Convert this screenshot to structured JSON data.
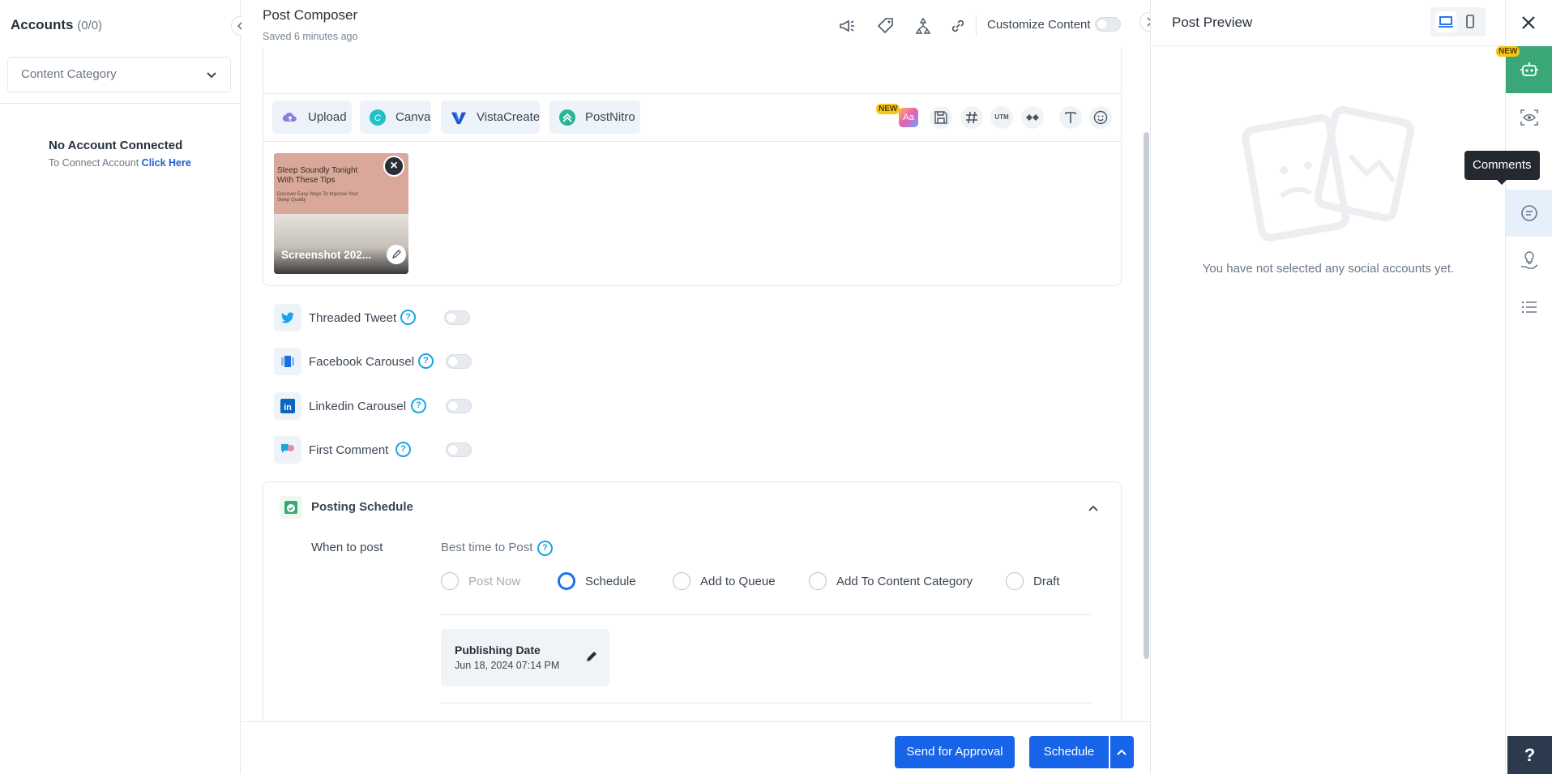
{
  "left_panel": {
    "title": "Accounts",
    "count": "(0/0)",
    "category_placeholder": "Content Category",
    "no_account": "No Account Connected",
    "connect_text": "To Connect Account",
    "connect_link": "Click Here"
  },
  "composer": {
    "title": "Post Composer",
    "saved": "Saved 6 minutes ago",
    "customize_label": "Customize Content",
    "header_icons": [
      "megaphone-icon",
      "tag-icon",
      "hierarchy-icon",
      "link-icon"
    ],
    "media_buttons": [
      {
        "label": "Upload",
        "icon": "cloud-upload-icon"
      },
      {
        "label": "Canva",
        "icon": "canva-icon"
      },
      {
        "label": "VistaCreate",
        "icon": "vistacreate-icon"
      },
      {
        "label": "PostNitro",
        "icon": "postnitro-icon"
      }
    ],
    "toolbar_new_badge": "NEW",
    "toolbar_ai_label": "Aa",
    "utm_label": "UTM",
    "thumbnail": {
      "headline": "Sleep Soundly Tonight With These Tips",
      "subline": "Discover Easy Ways To Improve Your Sleep Quality",
      "name": "Screenshot 202..."
    },
    "options": [
      {
        "label": "Threaded Tweet",
        "icon": "twitter-icon"
      },
      {
        "label": "Facebook Carousel",
        "icon": "carousel-icon"
      },
      {
        "label": "Linkedin Carousel",
        "icon": "linkedin-icon"
      },
      {
        "label": "First Comment",
        "icon": "comment-icon"
      }
    ],
    "help_glyph": "?",
    "schedule": {
      "title": "Posting Schedule",
      "when_label": "When to post",
      "best_time": "Best time to Post",
      "radios": [
        {
          "label": "Post Now",
          "selected": false,
          "disabled": true
        },
        {
          "label": "Schedule",
          "selected": true,
          "disabled": false
        },
        {
          "label": "Add to Queue",
          "selected": false,
          "disabled": false
        },
        {
          "label": "Add To Content Category",
          "selected": false,
          "disabled": false
        },
        {
          "label": "Draft",
          "selected": false,
          "disabled": false
        }
      ],
      "pub_label": "Publishing Date",
      "pub_value": "Jun 18, 2024 07:14 PM"
    },
    "footer": {
      "approval": "Send for Approval",
      "schedule": "Schedule"
    }
  },
  "preview": {
    "title": "Post Preview",
    "empty_text": "You have not selected any social accounts yet."
  },
  "rail": {
    "new_badge": "NEW",
    "tooltip": "Comments",
    "help": "?"
  },
  "colors": {
    "primary": "#1764e8",
    "accent_green": "#3ba776",
    "rail_active": "#e6f0fb"
  }
}
